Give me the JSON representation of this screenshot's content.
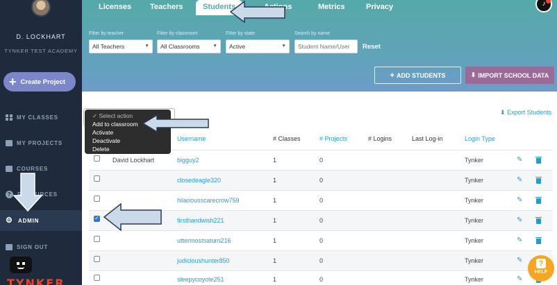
{
  "sidebar": {
    "user_name": "D. LOCKHART",
    "org": "TYNKER TEST ACADEMY",
    "create_label": "Create Project",
    "items": [
      {
        "label": "MY CLASSES"
      },
      {
        "label": "MY PROJECTS"
      },
      {
        "label": "COURSES"
      },
      {
        "label": "RESOURCES"
      },
      {
        "label": "ADMIN"
      },
      {
        "label": "SIGN OUT"
      }
    ],
    "brand": "TYNKER"
  },
  "tabs": [
    {
      "label": "Licenses"
    },
    {
      "label": "Teachers"
    },
    {
      "label": "Students"
    },
    {
      "label": "Actions"
    },
    {
      "label": "Metrics"
    },
    {
      "label": "Privacy"
    }
  ],
  "filters": {
    "teacher": {
      "label": "Filter by teacher",
      "value": "All Teachers"
    },
    "classroom": {
      "label": "Filter by classroom",
      "value": "All Classrooms"
    },
    "state": {
      "label": "Filter by state",
      "value": "Active"
    },
    "search": {
      "label": "Search by name",
      "placeholder": "Student Name/User"
    },
    "reset": "Reset"
  },
  "buttons": {
    "add_students": "ADD STUDENTS",
    "import_school_data": "IMPORT SCHOOL DATA",
    "export_students": "Export Students",
    "help": "HELP"
  },
  "action_menu": {
    "options": [
      "Select action",
      "Add to classroom",
      "Activate",
      "Deactivate",
      "Delete"
    ]
  },
  "table": {
    "headers": [
      "Username",
      "# Classes",
      "# Projects",
      "# Logins",
      "Last Log-in",
      "Login Type"
    ],
    "rows": [
      {
        "teacher": "David Lockhart",
        "username": "bigguy2",
        "classes": "1",
        "projects": "0",
        "login_type": "Tynker",
        "checked": false
      },
      {
        "teacher": "",
        "username": "closedeagle320",
        "classes": "1",
        "projects": "0",
        "login_type": "Tynker",
        "checked": false
      },
      {
        "teacher": "",
        "username": "hilariousscarecrow759",
        "classes": "1",
        "projects": "0",
        "login_type": "Tynker",
        "checked": false
      },
      {
        "teacher": "",
        "username": "firsthandwish221",
        "classes": "1",
        "projects": "0",
        "login_type": "Tynker",
        "checked": true
      },
      {
        "teacher": "",
        "username": "uttermostsaturn216",
        "classes": "1",
        "projects": "0",
        "login_type": "Tynker",
        "checked": false
      },
      {
        "teacher": "",
        "username": "judicioushunter850",
        "classes": "1",
        "projects": "0",
        "login_type": "Tynker",
        "checked": false
      },
      {
        "teacher": "",
        "username": "sleepycoyote251",
        "classes": "1",
        "projects": "0",
        "login_type": "Tynker",
        "checked": false
      }
    ]
  },
  "colors": {
    "sidebar_bg": "#1f2b3c",
    "accent": "#2a9bc9",
    "header_teal": "#55a9a8",
    "import_purple": "#9a6a99",
    "help_orange": "#f5a623"
  }
}
